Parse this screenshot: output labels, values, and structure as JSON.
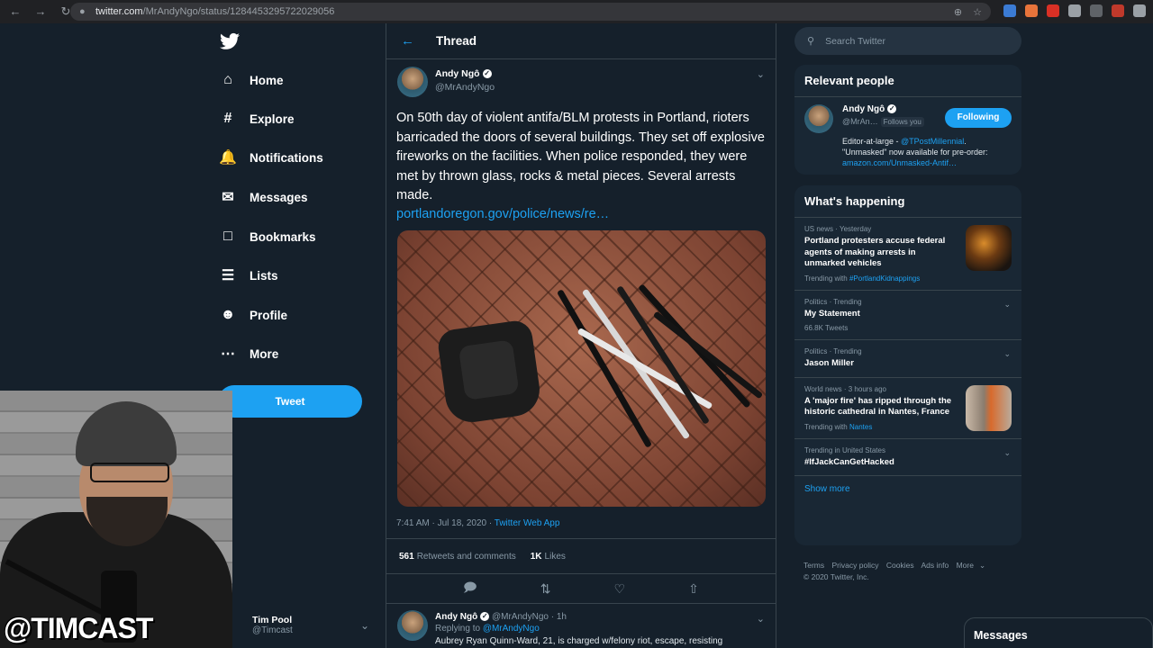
{
  "browser": {
    "url_host": "twitter.com",
    "url_path": "/MrAndyNgo/status/1284453295722029056"
  },
  "nav": {
    "items": [
      {
        "label": "Home",
        "icon": "home-icon"
      },
      {
        "label": "Explore",
        "icon": "hash-icon"
      },
      {
        "label": "Notifications",
        "icon": "bell-icon"
      },
      {
        "label": "Messages",
        "icon": "mail-icon"
      },
      {
        "label": "Bookmarks",
        "icon": "bookmark-icon"
      },
      {
        "label": "Lists",
        "icon": "list-icon"
      },
      {
        "label": "Profile",
        "icon": "person-icon"
      },
      {
        "label": "More",
        "icon": "more-icon"
      }
    ],
    "tweet_button": "Tweet",
    "account_name": "Tim Pool",
    "account_handle": "@Timcast"
  },
  "thread": {
    "header": "Thread",
    "author_name": "Andy Ngô",
    "author_handle": "@MrAndyNgo",
    "text": "On 50th day of violent antifa/BLM protests in Portland, rioters barricaded the doors of several buildings. They set off explosive fireworks on the facilities. When police responded, they were met by thrown glass, rocks & metal pieces. Several arrests made.",
    "link": "portlandoregon.gov/police/news/re…",
    "timestamp": "7:41 AM · Jul 18, 2020 ·",
    "source": "Twitter Web App",
    "retweets_count": "561",
    "retweets_label": "Retweets and comments",
    "likes_count": "1K",
    "likes_label": "Likes"
  },
  "reply": {
    "author_name": "Andy Ngô",
    "author_handle": "@MrAndyNgo · 1h",
    "replying_label": "Replying to",
    "replying_to": "@MrAndyNgo",
    "text": "Aubrey Ryan Quinn-Ward, 21, is charged w/felony riot, escape, resisting"
  },
  "search": {
    "placeholder": "Search Twitter"
  },
  "relevant": {
    "title": "Relevant people",
    "name": "Andy Ngô",
    "handle": "@MrAn…",
    "follows_you": "Follows you",
    "button": "Following",
    "bio_prefix": "Editor-at-large -",
    "bio_mention": "@TPostMillennial",
    "bio_mid": ". \"Unmasked\" now available for pre-order:",
    "bio_link": "amazon.com/Unmasked-Antif…"
  },
  "happening": {
    "title": "What's happening",
    "trends": [
      {
        "context": "US news · Yesterday",
        "title": "Portland protesters accuse federal agents of making arrests in unmarked vehicles",
        "sub_prefix": "Trending with",
        "sub_link": "#PortlandKidnappings",
        "thumb": true,
        "chev": false
      },
      {
        "context": "Politics · Trending",
        "title": "My Statement",
        "sub_prefix": "66.8K Tweets",
        "sub_link": "",
        "thumb": false,
        "chev": true
      },
      {
        "context": "Politics · Trending",
        "title": "Jason Miller",
        "sub_prefix": "",
        "sub_link": "",
        "thumb": false,
        "chev": true
      },
      {
        "context": "World news · 3 hours ago",
        "title": "A 'major fire' has ripped through the historic cathedral in Nantes, France",
        "sub_prefix": "Trending with",
        "sub_link": "Nantes",
        "thumb": true,
        "chev": false
      },
      {
        "context": "Trending in United States",
        "title": "#IfJackCanGetHacked",
        "sub_prefix": "",
        "sub_link": "",
        "thumb": false,
        "chev": true
      }
    ],
    "show_more": "Show more"
  },
  "footer": {
    "links": [
      "Terms",
      "Privacy policy",
      "Cookies",
      "Ads info",
      "More"
    ],
    "copyright": "© 2020 Twitter, Inc."
  },
  "messages_drawer": "Messages",
  "webcam_overlay": "@TIMCAST",
  "colors": {
    "bg": "#15202b",
    "panel": "#192734",
    "accent": "#1da1f2",
    "muted": "#8899a6"
  }
}
